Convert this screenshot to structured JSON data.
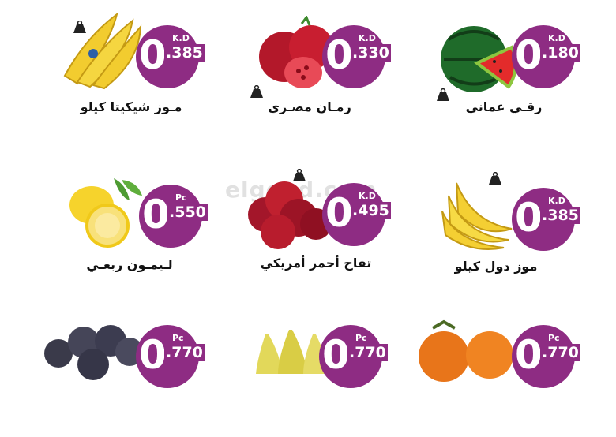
{
  "watermark": "elgood.com",
  "colors": {
    "badge": "#8e2c83",
    "text": "#111111"
  },
  "products": [
    {
      "name": "رقـي عماني",
      "int": "0",
      "dec": ".180",
      "unit": "K.D",
      "fruit": "watermelon-image",
      "kg_icon": true
    },
    {
      "name": "رمـان مصـري",
      "int": "0",
      "dec": ".330",
      "unit": "K.D",
      "fruit": "pomegranate-image",
      "kg_icon": true
    },
    {
      "name": "مـوز شيكيتا كيلو",
      "int": "0",
      "dec": ".385",
      "unit": "K.D",
      "fruit": "chiquita-banana-image",
      "kg_icon": true
    },
    {
      "name": "موز دول كيلو",
      "int": "0",
      "dec": ".385",
      "unit": "K.D",
      "fruit": "dole-banana-image",
      "kg_icon": true
    },
    {
      "name": "تفاح أحمر أمريكي",
      "int": "0",
      "dec": ".495",
      "unit": "K.D",
      "fruit": "red-apple-image",
      "kg_icon": true
    },
    {
      "name": "لـيمـون ربعـي",
      "int": "0",
      "dec": ".550",
      "unit": "Pc",
      "fruit": "lemon-image",
      "kg_icon": false
    },
    {
      "name": "",
      "int": "0",
      "dec": ".770",
      "unit": "Pc",
      "fruit": "persimmon-image",
      "kg_icon": false
    },
    {
      "name": "",
      "int": "0",
      "dec": ".770",
      "unit": "Pc",
      "fruit": "pear-image",
      "kg_icon": false
    },
    {
      "name": "",
      "int": "0",
      "dec": ".770",
      "unit": "Pc",
      "fruit": "plum-image",
      "kg_icon": false
    }
  ]
}
